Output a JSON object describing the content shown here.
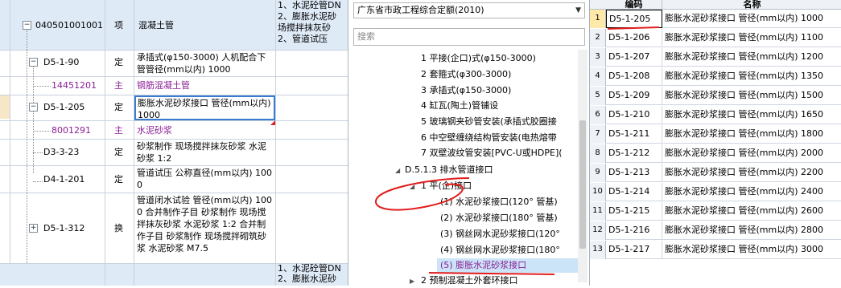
{
  "left_grid": {
    "rows": [
      {
        "code": "040501001001",
        "type": "项",
        "name": "混凝土管",
        "feature": "1、水泥砼管DN\n2、膨胀水泥砂\n场搅拌抹灰砂\n2、管道试压"
      },
      {
        "code": "D5-1-90",
        "type": "定",
        "name": "承插式(φ150-3000) 人机配合下管管径(mm以内) 1000",
        "feature": ""
      },
      {
        "code": "14451201",
        "type": "主",
        "name": "钢筋混凝土管",
        "feature": ""
      },
      {
        "code": "D5-1-205",
        "type": "定",
        "name": "膨胀水泥砂浆接口 管径(mm以内) 1000",
        "feature": ""
      },
      {
        "code": "8001291",
        "type": "主",
        "name": "水泥砂浆",
        "feature": ""
      },
      {
        "code": "D3-3-23",
        "type": "定",
        "name": "砂浆制作 现场搅拌抹灰砂浆 水泥砂浆 1:2",
        "feature": ""
      },
      {
        "code": "D4-1-201",
        "type": "定",
        "name": "管道试压 公称直径(mm以内) 1000",
        "feature": ""
      },
      {
        "code": "D5-1-312",
        "type": "换",
        "name": "管道闭水试验 管径(mm以内) 1000  合并制作子目 砂浆制作 现场搅拌抹灰砂浆 水泥砂浆 1:2  合并制作子目 砂浆制作 现场搅拌砌筑砂浆 水泥砂浆 M7.5",
        "feature": ""
      },
      {
        "code": "",
        "type": "",
        "name": "",
        "feature": "1、水泥砼管DN\n2、膨胀水泥砂"
      }
    ]
  },
  "tree_panel": {
    "quota_select": "广东省市政工程综合定额(2010)",
    "search_placeholder": "搜索",
    "items": [
      "1 平接(企口)式(φ150-3000)",
      "2 套箍式(φ300-3000)",
      "3 承插式(φ150-3000)",
      "4 缸瓦(陶土)管铺设",
      "5 玻璃钢夹砂管安装(承插式胶圈接",
      "6 中空壁缠绕结构管安装(电热熔带",
      "7 双壁波纹管安装[PVC-U或HDPE](",
      "D.5.1.3 排水管道接口",
      "1 平(企)接口",
      "(1) 水泥砂浆接口(120° 管基)",
      "(2) 水泥砂浆接口(180° 管基)",
      "(3) 钢丝网水泥砂浆接口(120°",
      "(4) 钢丝网水泥砂浆接口(180°",
      "(5) 膨胀水泥砂浆接口",
      "2 预制混凝土外套环接口"
    ]
  },
  "right_table": {
    "headers": {
      "code": "编码",
      "name": "名称"
    },
    "rows": [
      {
        "num": "1",
        "code": "D5-1-205",
        "name": "膨胀水泥砂浆接口 管径(mm以内) 1000"
      },
      {
        "num": "2",
        "code": "D5-1-206",
        "name": "膨胀水泥砂浆接口 管径(mm以内) 1100"
      },
      {
        "num": "3",
        "code": "D5-1-207",
        "name": "膨胀水泥砂浆接口 管径(mm以内) 1200"
      },
      {
        "num": "4",
        "code": "D5-1-208",
        "name": "膨胀水泥砂浆接口 管径(mm以内) 1350"
      },
      {
        "num": "5",
        "code": "D5-1-209",
        "name": "膨胀水泥砂浆接口 管径(mm以内) 1500"
      },
      {
        "num": "6",
        "code": "D5-1-210",
        "name": "膨胀水泥砂浆接口 管径(mm以内) 1650"
      },
      {
        "num": "7",
        "code": "D5-1-211",
        "name": "膨胀水泥砂浆接口 管径(mm以内) 1800"
      },
      {
        "num": "8",
        "code": "D5-1-212",
        "name": "膨胀水泥砂浆接口 管径(mm以内) 2000"
      },
      {
        "num": "9",
        "code": "D5-1-213",
        "name": "膨胀水泥砂浆接口 管径(mm以内) 2200"
      },
      {
        "num": "10",
        "code": "D5-1-214",
        "name": "膨胀水泥砂浆接口 管径(mm以内) 2400"
      },
      {
        "num": "11",
        "code": "D5-1-215",
        "name": "膨胀水泥砂浆接口 管径(mm以内) 2600"
      },
      {
        "num": "12",
        "code": "D5-1-216",
        "name": "膨胀水泥砂浆接口 管径(mm以内) 2800"
      },
      {
        "num": "13",
        "code": "D5-1-217",
        "name": "膨胀水泥砂浆接口 管径(mm以内) 3000"
      }
    ]
  },
  "colors": {
    "annotation_red": "#e21d1d",
    "main_purple": "#8a1e96",
    "selection_blue": "#cce4f7"
  }
}
